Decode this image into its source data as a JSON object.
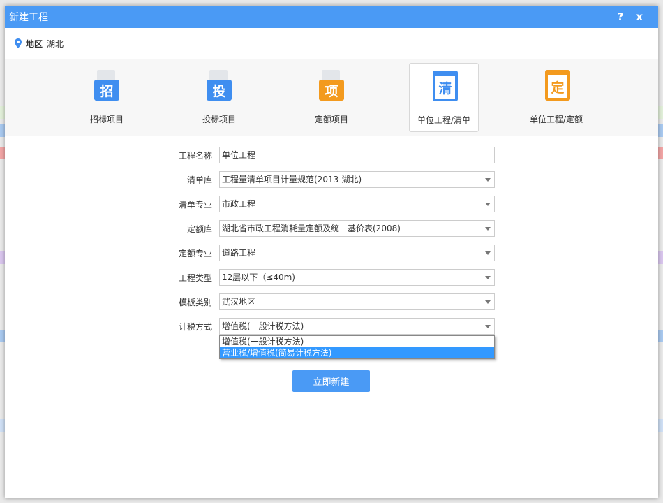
{
  "dialog": {
    "title": "新建工程",
    "help": "?",
    "close": "x"
  },
  "region": {
    "label": "地区",
    "value": "湖北"
  },
  "types": [
    {
      "label": "招标项目",
      "glyph": "招",
      "color": "#3f8ef0"
    },
    {
      "label": "投标项目",
      "glyph": "投",
      "color": "#3f8ef0"
    },
    {
      "label": "定额项目",
      "glyph": "项",
      "color": "#f39a1e"
    },
    {
      "label": "单位工程/清单",
      "glyph": "清",
      "color": "#3f8ef0",
      "selected": true
    },
    {
      "label": "单位工程/定额",
      "glyph": "定",
      "color": "#f39a1e"
    }
  ],
  "form": [
    {
      "label": "工程名称",
      "value": "单位工程"
    },
    {
      "label": "清单库",
      "value": "工程量清单项目计量规范(2013-湖北)"
    },
    {
      "label": "清单专业",
      "value": "市政工程"
    },
    {
      "label": "定额库",
      "value": "湖北省市政工程消耗量定额及统一基价表(2008)"
    },
    {
      "label": "定额专业",
      "value": "道路工程"
    },
    {
      "label": "工程类型",
      "value": "12层以下（≤40m)"
    },
    {
      "label": "模板类别",
      "value": "武汉地区"
    },
    {
      "label": "计税方式",
      "value": "增值税(一般计税方法)"
    }
  ],
  "tax_options": [
    "增值税(一般计税方法)",
    "营业税/增值税(简易计税方法)"
  ],
  "create_button": "立即新建"
}
